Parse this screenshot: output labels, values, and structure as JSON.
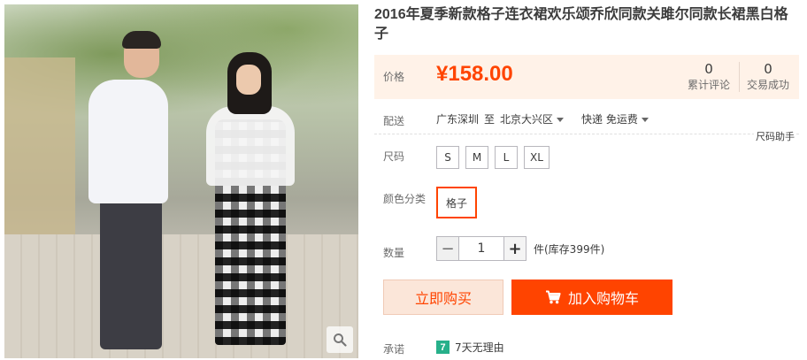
{
  "product": {
    "title": "2016年夏季新款格子连衣裙欢乐颂乔欣同款关雎尔同款长裙黑白格子"
  },
  "price": {
    "label": "价格",
    "value": "¥158.00",
    "reviews_count": "0",
    "reviews_label": "累计评论",
    "sales_count": "0",
    "sales_label": "交易成功",
    "color": "#ff4400"
  },
  "shipping": {
    "label": "配送",
    "from": "广东深圳",
    "to_word": "至",
    "to": "北京大兴区",
    "method": "快递 免运费",
    "size_help": "尺码助手"
  },
  "size": {
    "label": "尺码",
    "options": [
      "S",
      "M",
      "L",
      "XL"
    ]
  },
  "color": {
    "label": "颜色分类",
    "selected": "格子",
    "accent": "#ff4400"
  },
  "quantity": {
    "label": "数量",
    "minus": "−",
    "value": "1",
    "plus": "+",
    "stock": "件(库存399件)"
  },
  "actions": {
    "buy_now": "立即购买",
    "add_to_cart": "加入购物车"
  },
  "promise": {
    "label": "承诺",
    "badge": "7",
    "text": "7天无理由"
  },
  "icons": {
    "zoom": "search-icon",
    "cart": "cart-icon"
  }
}
